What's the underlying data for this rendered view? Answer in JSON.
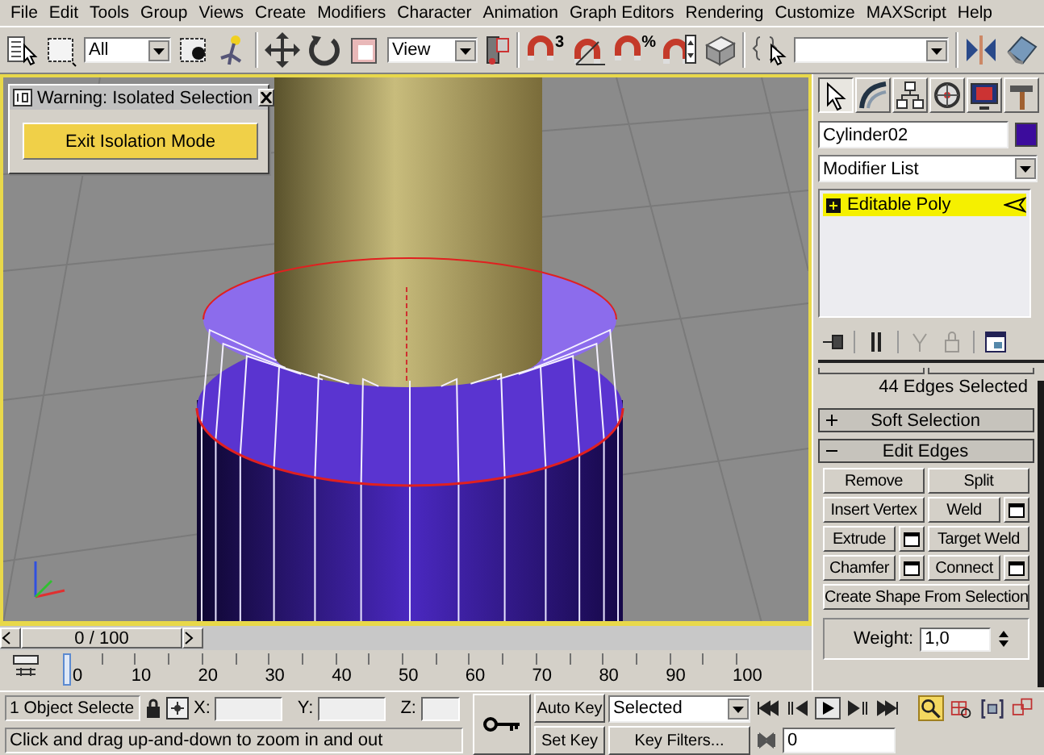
{
  "menu": [
    "File",
    "Edit",
    "Tools",
    "Group",
    "Views",
    "Create",
    "Modifiers",
    "Character",
    "Animation",
    "Graph Editors",
    "Rendering",
    "Customize",
    "MAXScript",
    "Help"
  ],
  "toolbar": {
    "selection_filter": "All",
    "reference_coord": "View",
    "snap_3d_label": "3",
    "percent_snap_label": "%"
  },
  "dialog": {
    "title": "Warning: Isolated Selection",
    "button": "Exit Isolation Mode"
  },
  "command_panel": {
    "tabs": [
      {
        "selected": true
      },
      {
        "selected": false
      },
      {
        "selected": false
      },
      {
        "selected": false
      },
      {
        "selected": false
      },
      {
        "selected": false
      }
    ],
    "object_name": "Cylinder02",
    "modifier_list": "Modifier List",
    "stack": [
      {
        "label": "Editable Poly",
        "selected": true,
        "expanded": false
      }
    ],
    "stack_tools": [
      {
        "disabled": false
      },
      {
        "disabled": false
      },
      {
        "disabled": true
      },
      {
        "disabled": true
      },
      {
        "disabled": false
      }
    ],
    "selection_status": "44 Edges Selected",
    "rollouts": [
      {
        "label": "Soft Selection",
        "expanded": false
      },
      {
        "label": "Edit Edges",
        "expanded": true
      }
    ],
    "edge_buttons": [
      [
        {
          "label": "Remove",
          "settings": false
        },
        {
          "label": "Split",
          "settings": false
        }
      ],
      [
        {
          "label": "Insert Vertex",
          "settings": false
        },
        {
          "label": "Weld",
          "settings": true
        }
      ],
      [
        {
          "label": "Extrude",
          "settings": true
        },
        {
          "label": "Target Weld",
          "settings": false
        }
      ],
      [
        {
          "label": "Chamfer",
          "settings": true
        },
        {
          "label": "Connect",
          "settings": true
        }
      ]
    ],
    "create_shape": "Create Shape From Selection",
    "weight": {
      "label": "Weight:",
      "value": "1,0"
    }
  },
  "time_slider": {
    "label": "0 / 100",
    "level": 0
  },
  "ruler_labels": [
    "0",
    "10",
    "20",
    "30",
    "40",
    "50",
    "60",
    "70",
    "80",
    "90",
    "100"
  ],
  "status": {
    "selection_count": "1 Object Selecte",
    "x_label": "X:",
    "y_label": "Y:",
    "z_label": "Z:",
    "prompt": "Click and drag up-and-down to zoom in and out"
  },
  "animation": {
    "auto_key": "Auto Key",
    "key_set": "Selected",
    "set_key": "Set Key",
    "key_filters": "Key Filters...",
    "frame": "0"
  },
  "nav_tools": [
    {
      "selected": true
    },
    {
      "selected": false
    },
    {
      "selected": false
    },
    {
      "selected": false
    }
  ]
}
